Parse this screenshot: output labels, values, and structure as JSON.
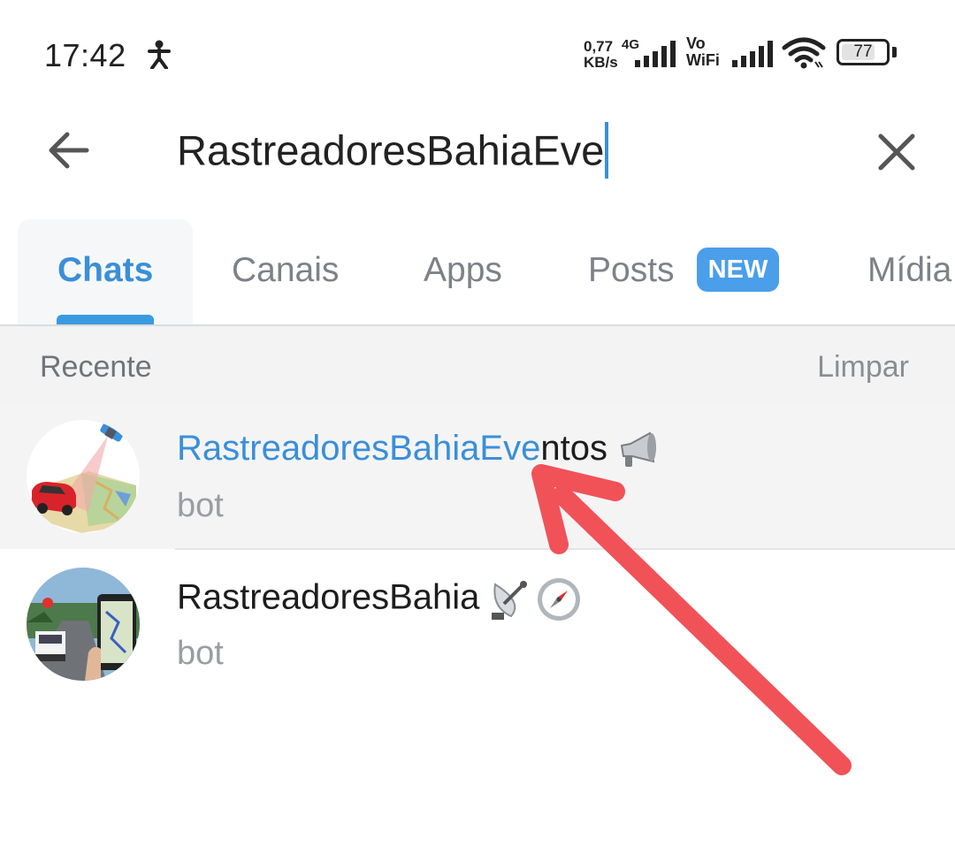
{
  "status_bar": {
    "time": "17:42",
    "net_speed_value": "0,77",
    "net_speed_unit": "KB/s",
    "network_gen": "4G",
    "vo_label": "Vo",
    "wifi_label": "WiFi",
    "battery": "77",
    "battery_level": 0.77
  },
  "search": {
    "query": "RastreadoresBahiaEve"
  },
  "tabs": [
    {
      "label": "Chats",
      "active": true
    },
    {
      "label": "Canais",
      "active": false
    },
    {
      "label": "Apps",
      "active": false
    },
    {
      "label": "Posts",
      "active": false,
      "badge": "NEW"
    },
    {
      "label": "Mídia",
      "active": false
    }
  ],
  "recent": {
    "title": "Recente",
    "clear_label": "Limpar"
  },
  "results": [
    {
      "name_match": "RastreadoresBahiaEve",
      "name_rest": "ntos",
      "emoji": "loudspeaker-icon",
      "subtitle": "bot"
    },
    {
      "name_match": "",
      "name_rest": "RastreadoresBahia",
      "emoji": "satellite-dish-compass-icon",
      "subtitle": "bot"
    }
  ],
  "colors": {
    "accent": "#3a8fd8",
    "badge": "#4a9eea",
    "annotation_arrow": "#f05258"
  }
}
